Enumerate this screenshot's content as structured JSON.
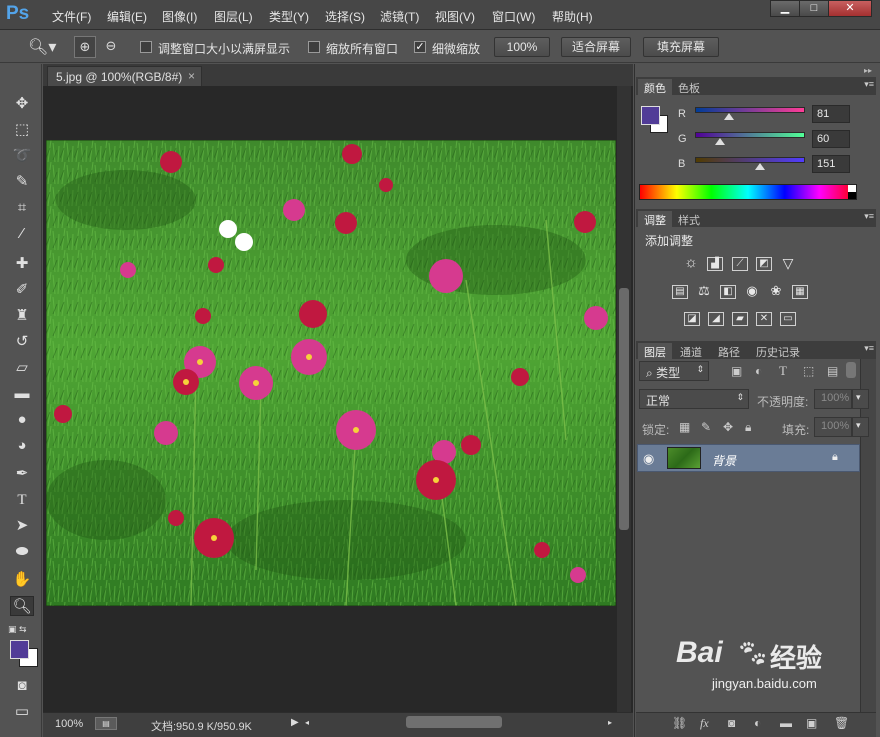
{
  "app": {
    "logo": "Ps"
  },
  "menu": [
    "文件(F)",
    "编辑(E)",
    "图像(I)",
    "图层(L)",
    "类型(Y)",
    "选择(S)",
    "滤镜(T)",
    "视图(V)",
    "窗口(W)",
    "帮助(H)"
  ],
  "options": {
    "resize_windows_label": "调整窗口大小以满屏显示",
    "zoom_all_label": "缩放所有窗口",
    "scrubby_zoom_label": "细微缩放",
    "scrubby_checked": true,
    "btn_100": "100%",
    "btn_fit": "适合屏幕",
    "btn_fill": "填充屏幕"
  },
  "document": {
    "tab_title": "5.jpg @ 100%(RGB/8#)",
    "close_glyph": "×",
    "zoom": "100%",
    "doc_size": "文档:950.9 K/950.9K"
  },
  "color_panel": {
    "tabs": [
      "颜色",
      "色板"
    ],
    "r_label": "R",
    "g_label": "G",
    "b_label": "B",
    "r": 81,
    "g": 60,
    "b": 151,
    "r_str": "81",
    "g_str": "60",
    "b_str": "151",
    "fg_color": "#513c97"
  },
  "adjust_panel": {
    "tabs": [
      "调整",
      "样式"
    ],
    "title": "添加调整"
  },
  "layers_panel": {
    "tabs": [
      "图层",
      "通道",
      "路径",
      "历史记录"
    ],
    "kind_filter": "类型",
    "blend_mode": "正常",
    "opacity_label": "不透明度:",
    "opacity_value": "100%",
    "lock_label": "锁定:",
    "fill_label": "填充:",
    "fill_value": "100%",
    "layer_name": "背景"
  },
  "watermark": {
    "text": "Bai",
    "text2": "经验",
    "url": "jingyan.baidu.com"
  },
  "colors": {
    "accent_blue": "#53a4ea",
    "layer_selected": "#6a7c96"
  }
}
